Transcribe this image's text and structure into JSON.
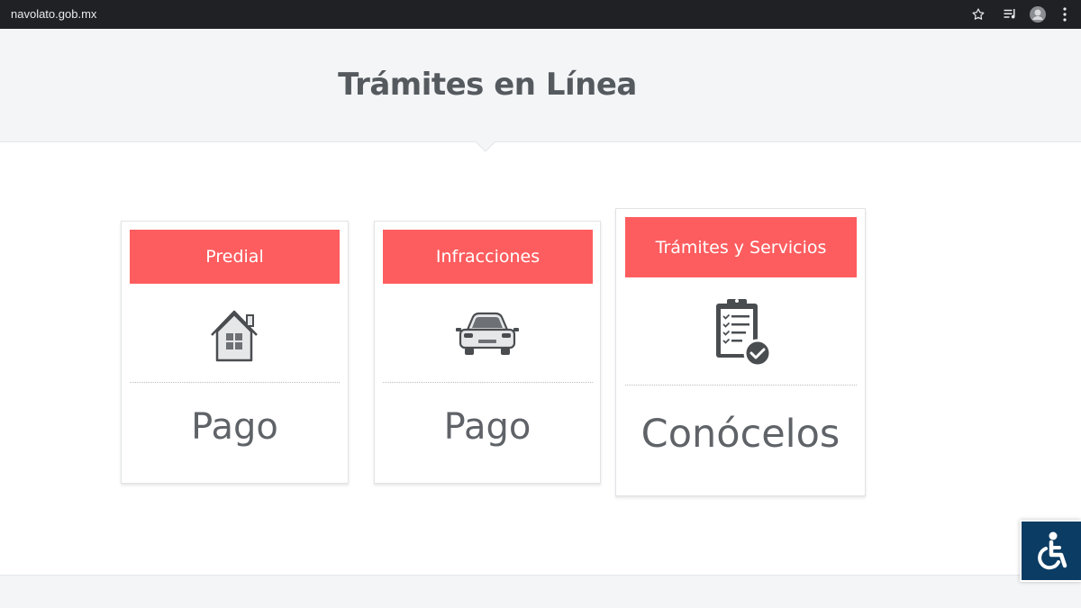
{
  "browser": {
    "url": "navolato.gob.mx",
    "icons": [
      "star-icon",
      "playlist-icon",
      "profile-icon",
      "menu-icon"
    ]
  },
  "header": {
    "title": "Trámites en Línea"
  },
  "cards": [
    {
      "button_label": "Predial",
      "icon": "house-icon",
      "caption": "Pago"
    },
    {
      "button_label": "Infracciones",
      "icon": "car-icon",
      "caption": "Pago"
    },
    {
      "button_label": "Trámites y Servicios",
      "icon": "clipboard-check-icon",
      "caption": "Conócelos"
    }
  ],
  "accessibility": {
    "icon": "wheelchair-icon"
  },
  "colors": {
    "accent": "#fd5d5f",
    "header_bg": "#f4f5f7",
    "text": "#5f6368",
    "a11y_bg": "#0b3c64"
  }
}
